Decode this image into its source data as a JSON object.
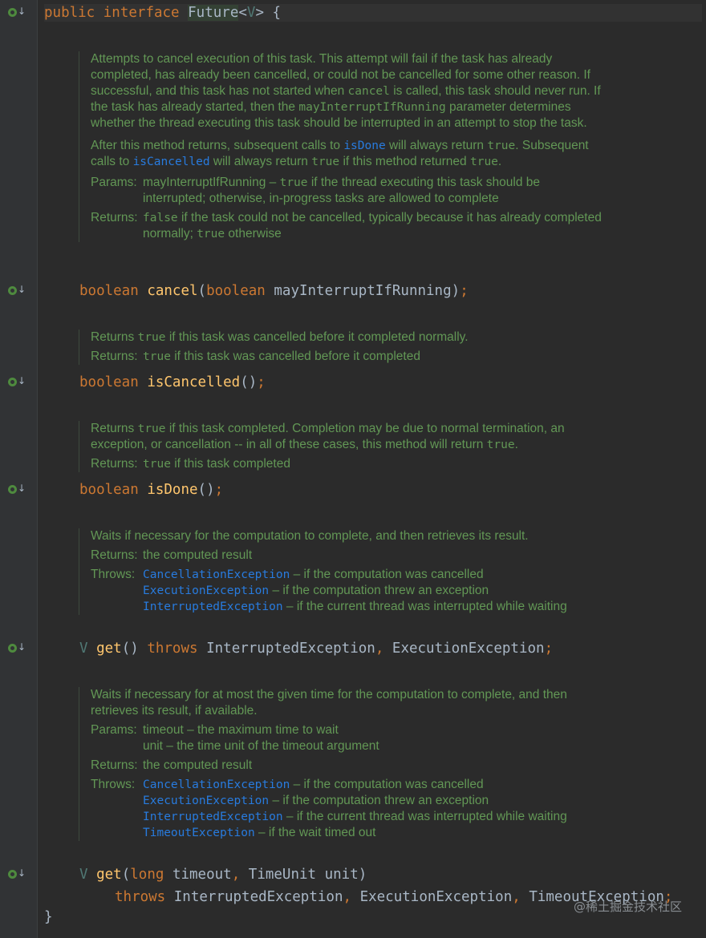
{
  "header": {
    "kw_public": "public",
    "kw_interface": "interface",
    "name": "Future",
    "lt": "<",
    "typevar": "V",
    "gt": ">",
    "brace": " {"
  },
  "cancel_doc": {
    "p1a": "Attempts to cancel execution of this task. This attempt will fail if the task has already completed, has already been cancelled, or could not be cancelled for some other reason. If successful, and this task has not started when ",
    "p1_code1": "cancel",
    "p1b": " is called, this task should never run. If the task has already started, then the ",
    "p1_code2": "mayInterruptIfRunning",
    "p1c": " parameter determines whether the thread executing this task should be interrupted in an attempt to stop the task.",
    "p2a": "After this method returns, subsequent calls to ",
    "p2_link1": "isDone",
    "p2b": " will always return ",
    "p2_code1": "true",
    "p2c": ". Subsequent calls to ",
    "p2_link2": "isCancelled",
    "p2d": " will always return ",
    "p2_code2": "true",
    "p2e": " if this method returned ",
    "p2_code3": "true",
    "p2f": ".",
    "params_label": "Params:",
    "params_name": "mayInterruptIfRunning",
    "params_dash": " – ",
    "params_code": "true",
    "params_rest": " if the thread executing this task should be interrupted; otherwise, in-progress tasks are allowed to complete",
    "returns_label": "Returns:",
    "returns_code1": "false",
    "returns_mid": " if the task could not be cancelled, typically because it has already completed normally; ",
    "returns_code2": "true",
    "returns_end": " otherwise"
  },
  "cancel_sig": {
    "kw": "boolean",
    "name": "cancel",
    "open": "(",
    "ptype": "boolean",
    "pname": " mayInterruptIfRunning",
    "close": ")",
    "semi": ";"
  },
  "iscancelled_doc": {
    "l1a": "Returns ",
    "l1_code": "true",
    "l1b": " if this task was cancelled before it completed normally.",
    "returns_label": "Returns:",
    "r_code": "true",
    "r_rest": " if this task was cancelled before it completed"
  },
  "iscancelled_sig": {
    "kw": "boolean",
    "name": "isCancelled",
    "parens": "()",
    "semi": ";"
  },
  "isdone_doc": {
    "l1a": "Returns ",
    "l1_code": "true",
    "l1b": " if this task completed. Completion may be due to normal termination, an exception, or cancellation -- in all of these cases, this method will return ",
    "l1_code2": "true",
    "l1c": ".",
    "returns_label": "Returns:",
    "r_code": "true",
    "r_rest": " if this task completed"
  },
  "isdone_sig": {
    "kw": "boolean",
    "name": "isDone",
    "parens": "()",
    "semi": ";"
  },
  "get_doc": {
    "l1": "Waits if necessary for the computation to complete, and then retrieves its result.",
    "returns_label": "Returns:",
    "returns_text": "the computed result",
    "throws_label": "Throws:",
    "t1": "CancellationException",
    "t1_rest": " – if the computation was cancelled",
    "t2": "ExecutionException",
    "t2_rest": " – if the computation threw an exception",
    "t3": "InterruptedException",
    "t3_rest": " – if the current thread was interrupted while waiting"
  },
  "get_sig": {
    "ret": "V",
    "name": "get",
    "parens": "()",
    "throws": "throws",
    "ex1": "InterruptedException",
    "comma": ",",
    "ex2": "ExecutionException",
    "semi": ";"
  },
  "gett_doc": {
    "l1": "Waits if necessary for at most the given time for the computation to complete, and then retrieves its result, if available.",
    "params_label": "Params:",
    "p1": "timeout – the maximum time to wait",
    "p2": "unit – the time unit of the timeout argument",
    "returns_label": "Returns:",
    "returns_text": "the computed result",
    "throws_label": "Throws:",
    "t1": "CancellationException",
    "t1_rest": " – if the computation was cancelled",
    "t2": "ExecutionException",
    "t2_rest": " – if the computation threw an exception",
    "t3": "InterruptedException",
    "t3_rest": " – if the current thread was interrupted while waiting",
    "t4": "TimeoutException",
    "t4_rest": " – if the wait timed out"
  },
  "gett_sig": {
    "ret": "V",
    "name": "get",
    "open": "(",
    "t1": "long",
    "p1": " timeout",
    "comma1": ",",
    "t2": " TimeUnit",
    "p2": " unit",
    "close": ")",
    "throws": "throws",
    "ex1": "InterruptedException",
    "comma2": ",",
    "ex2": "ExecutionException",
    "comma3": ",",
    "ex3": "TimeoutException",
    "semi": ";"
  },
  "footer": {
    "brace": "}"
  },
  "watermark": "@稀土掘金技术社区"
}
